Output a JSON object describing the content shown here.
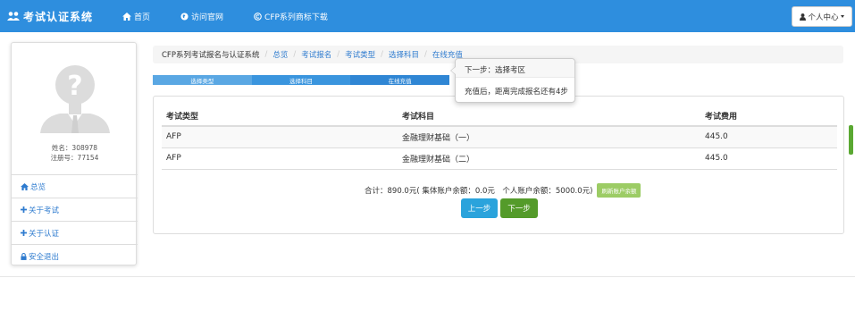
{
  "navbar": {
    "brand": "考试认证系统",
    "links": [
      {
        "label": "首页",
        "icon": "home-icon"
      },
      {
        "label": "访问官网",
        "icon": "globe-icon"
      },
      {
        "label": "CFP系列商标下载",
        "icon": "copyright-icon"
      }
    ],
    "user_menu": "个人中心",
    "colors": {
      "primary": "#2e8ede",
      "success": "#549b2a",
      "info": "#2aa3dc",
      "refresh": "#9ccc65"
    }
  },
  "sidebar": {
    "name_line": "姓名：308978",
    "reg_line": "注册号：77154",
    "items": [
      {
        "label": "总览",
        "icon": "home-icon"
      },
      {
        "label": "关于考试",
        "icon": "plus-icon"
      },
      {
        "label": "关于认证",
        "icon": "plus-icon"
      },
      {
        "label": "安全退出",
        "icon": "lock-icon"
      }
    ]
  },
  "breadcrumb": [
    "CFP系列考试报名与认证系统",
    "总览",
    "考试报名",
    "考试类型",
    "选择科目",
    "在线充值"
  ],
  "steps": [
    "选择类型",
    "选择科目",
    "在线充值"
  ],
  "popover": {
    "title": "下一步：选择考区",
    "body": "充值后，距离完成报名还有4步"
  },
  "table": {
    "headers": [
      "考试类型",
      "考试科目",
      "考试费用"
    ],
    "rows": [
      [
        "AFP",
        "金融理财基础（一）",
        "445.0"
      ],
      [
        "AFP",
        "金融理财基础（二）",
        "445.0"
      ]
    ]
  },
  "summary": {
    "text": "合计：890.0元( 集体账户余额：0.0元　个人账户余额：5000.0元)",
    "refresh_label": "刷新账户余额"
  },
  "buttons": {
    "prev": "上一步",
    "next": "下一步"
  }
}
